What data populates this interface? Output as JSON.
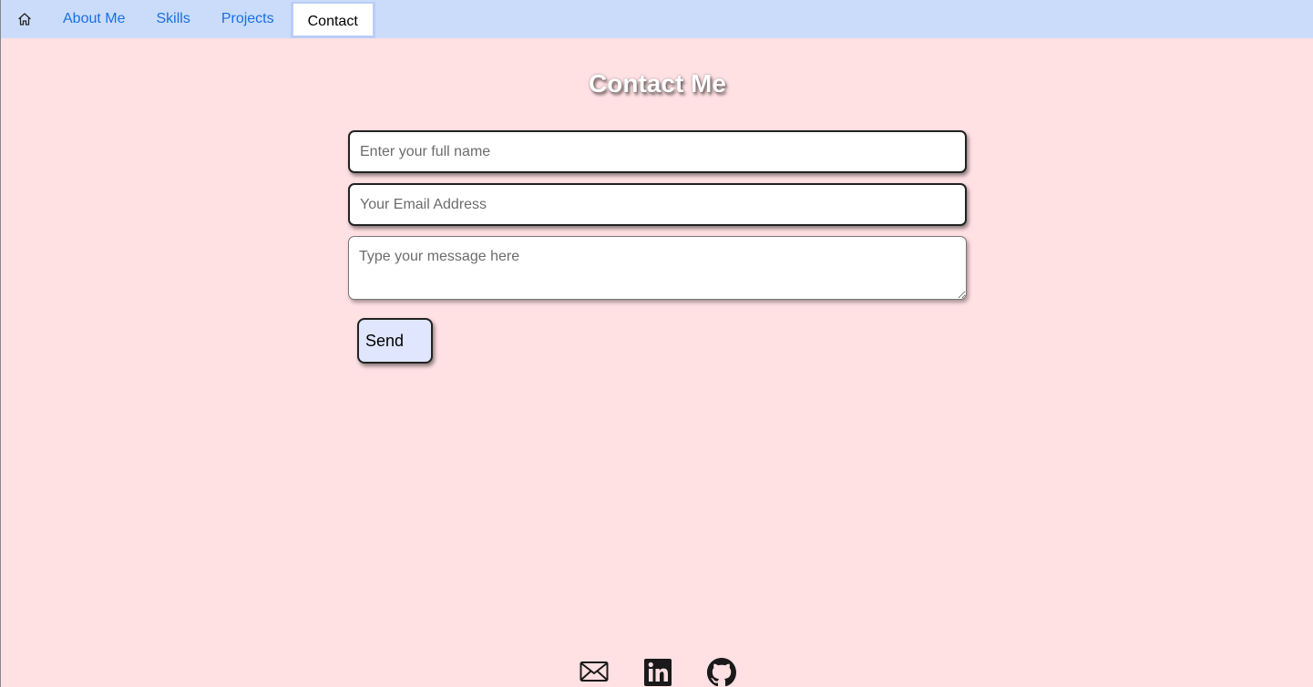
{
  "nav": {
    "home_icon": "house-icon",
    "links": [
      {
        "label": "About Me"
      },
      {
        "label": "Skills"
      },
      {
        "label": "Projects"
      },
      {
        "label": "Contact",
        "active": true
      }
    ]
  },
  "main": {
    "title": "Contact Me",
    "form": {
      "name_placeholder": "Enter your full name",
      "name_value": "",
      "email_placeholder": "Your Email Address",
      "email_value": "",
      "message_placeholder": "Type your message here",
      "message_value": "",
      "send_label": "Send"
    }
  },
  "footer": {
    "icons": [
      "envelope-icon",
      "linkedin-icon",
      "github-icon"
    ]
  },
  "colors": {
    "page_bg": "#ffe0e3",
    "navbar_bg": "#cbdcfb",
    "nav_link": "#1a6fe0",
    "send_bg": "#dfe6fd"
  }
}
